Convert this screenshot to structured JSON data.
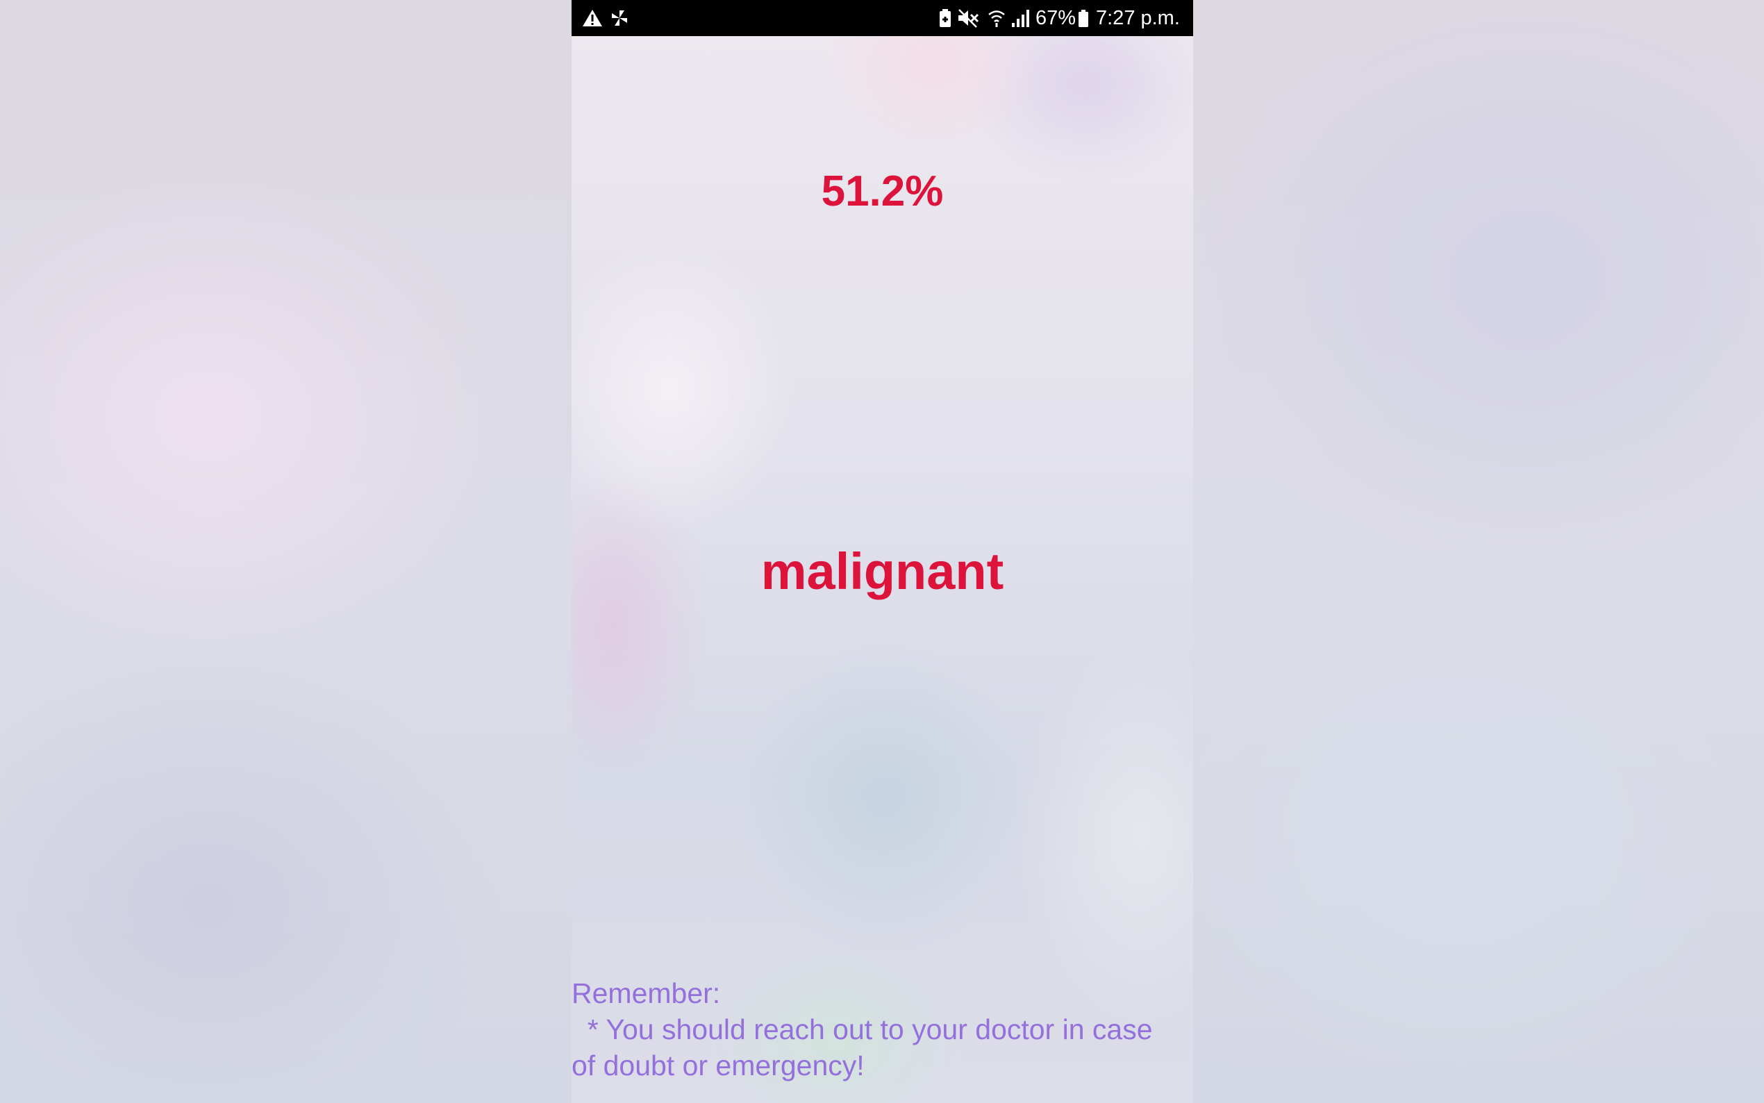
{
  "status_bar": {
    "icons": [
      "warning-icon",
      "pinwheel-icon",
      "battery-saver-icon",
      "mute-icon",
      "wifi-icon",
      "signal-icon",
      "battery-icon"
    ],
    "battery_percent": "67%",
    "time": "7:27 p.m."
  },
  "result": {
    "percentage": "51.2%",
    "label": "malignant",
    "color": "#dc143c"
  },
  "reminder": {
    "heading": "Remember:",
    "text": "  * You should reach out to your doctor in case of doubt or emergency!",
    "color": "#9370db"
  },
  "colors": {
    "status_bar_bg": "#000000"
  }
}
